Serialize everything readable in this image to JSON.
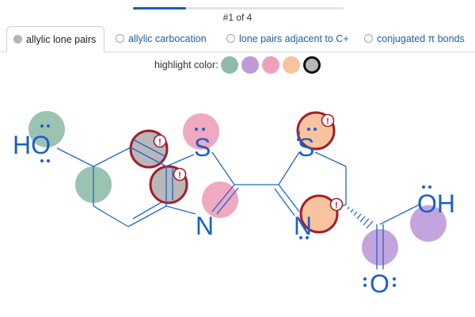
{
  "progress": {
    "fraction": 0.25
  },
  "counter": "#1 of 4",
  "tabs": [
    {
      "label": "allylic lone pairs",
      "active": true
    },
    {
      "label": "allylic carbocation",
      "active": false
    },
    {
      "label": "lone pairs adjacent to C+",
      "active": false
    },
    {
      "label": "conjugated π bonds",
      "active": false
    }
  ],
  "highlight": {
    "label": "highlight color:",
    "swatches": [
      "#8fbca8",
      "#bd9ad8",
      "#ef9fba",
      "#f8c49f",
      "#b8b8b8"
    ],
    "selected_index": 4
  },
  "molecule": {
    "atoms": {
      "ho": "HO",
      "s1": "S",
      "n1": "N",
      "s2": "S",
      "n2": "N",
      "oh": "OH",
      "o": "O"
    },
    "colors": {
      "bond": "#2266cc",
      "mark_ring": "#a51d2d",
      "lone_pair": "#1a5fc8"
    }
  }
}
